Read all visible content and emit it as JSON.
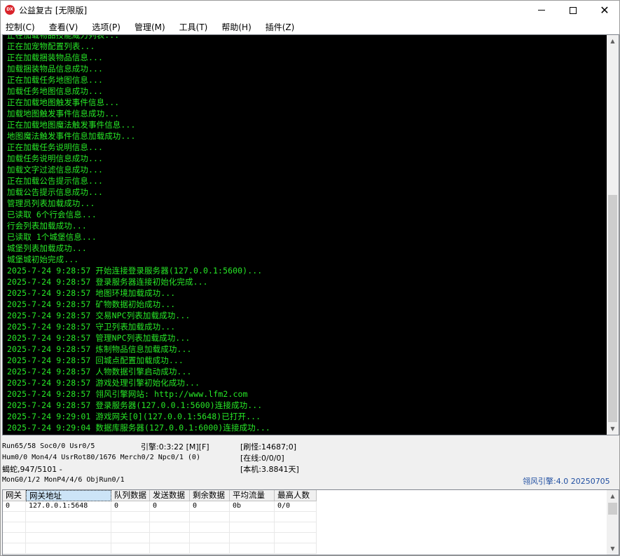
{
  "window": {
    "icon_text": "DX",
    "title": "公益复古 [无限版]",
    "minimize_icon": "minimize-icon",
    "maximize_icon": "maximize-icon",
    "close_glyph": "✕"
  },
  "menu": [
    {
      "label": "控制(C)"
    },
    {
      "label": "查看(V)"
    },
    {
      "label": "选项(P)"
    },
    {
      "label": "管理(M)"
    },
    {
      "label": "工具(T)"
    },
    {
      "label": "帮助(H)"
    },
    {
      "label": "插件(Z)"
    }
  ],
  "log": {
    "text_color": "#27e827",
    "lines": [
      "正在加载物品技能威力列表...",
      "正在加宠物配置列表...",
      "正在加载捆装物品信息...",
      "加载捆装物品信息成功...",
      "正在加载任务地图信息...",
      "加载任务地图信息成功...",
      "正在加载地图触发事件信息...",
      "加载地图触发事件信息成功...",
      "正在加载地图魔法触发事件信息...",
      "地图魔法触发事件信息加载成功...",
      "正在加载任务说明信息...",
      "加载任务说明信息成功...",
      "加载文字过滤信息成功...",
      "正在加载公告提示信息...",
      "加载公告提示信息成功...",
      "管理员列表加载成功...",
      "已读取 6个行会信息...",
      "行会列表加载成功...",
      "已读取 1个城堡信息...",
      "城堡列表加载成功...",
      "城堡城初始完成...",
      "2025-7-24 9:28:57 开始连接登录服务器(127.0.0.1:5600)...",
      "2025-7-24 9:28:57 登录服务器连接初始化完成...",
      "2025-7-24 9:28:57 地图环境加载成功...",
      "2025-7-24 9:28:57 矿物数据初始成功...",
      "2025-7-24 9:28:57 交易NPC列表加载成功...",
      "2025-7-24 9:28:57 守卫列表加载成功...",
      "2025-7-24 9:28:57 管理NPC列表加载成功...",
      "2025-7-24 9:28:57 炼制物品信息加载成功...",
      "2025-7-24 9:28:57 回城点配置加载成功...",
      "2025-7-24 9:28:57 人物数据引擎启动成功...",
      "2025-7-24 9:28:57 游戏处理引擎初始化成功...",
      "2025-7-24 9:28:57 翎风引擎网站: http://www.lfm2.com",
      "2025-7-24 9:28:57 登录服务器(127.0.0.1:5600)连接成功...",
      "2025-7-24 9:29:01 游戏网关[0](127.0.0.1:5648)已打开...",
      "2025-7-24 9:29:04 数据库服务器(127.0.0.1:6000)连接成功..."
    ]
  },
  "status": {
    "run": "Run65/58 Soc0/0 Usr0/5",
    "engine": "引擎:0:3:22 [M][F]",
    "refresh": "[刷怪:14687;0]",
    "hum": "Hum0/0 Mon4/4 UsrRot80/1676 Merch0/2 Npc0/1 (0)",
    "online": "[在线:0/0/0]",
    "snake": "蝎蛇,947/5101 -",
    "local": "[本机:3.8841天]",
    "mongo": "MonG0/1/2 MonP4/4/6 ObjRun0/1",
    "version": "翎风引擎:4.0 20250705",
    "version_color": "#1f4ea1"
  },
  "gateway_table": {
    "columns": [
      "网关",
      "网关地址",
      "队列数据",
      "发送数据",
      "剩余数据",
      "平均流量",
      "最高人数"
    ],
    "rows": [
      [
        "0",
        "127.0.0.1:5648",
        "0",
        "0",
        "0",
        "0b",
        "0/0"
      ]
    ],
    "empty_rows": 4
  }
}
